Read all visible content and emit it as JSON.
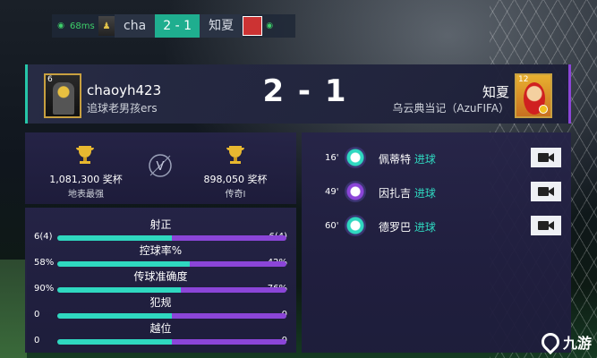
{
  "topbar": {
    "ping": "68ms",
    "home_name": "cha",
    "score": "2 - 1",
    "away_name": "知夏"
  },
  "header": {
    "home": {
      "name": "chaoyh423",
      "team": "追球老男孩ers",
      "level": "6"
    },
    "score": "2 - 1",
    "away": {
      "name": "知夏",
      "team": "乌云典当记（AzuFIFA）",
      "level": "12"
    }
  },
  "trophies": {
    "home": {
      "value": "1,081,300 奖杯",
      "rank": "地表最强"
    },
    "away": {
      "value": "898,050 奖杯",
      "rank": "传奇I"
    },
    "vs": "V"
  },
  "stats": [
    {
      "label": "射正",
      "home": "6(4)",
      "away": "6(4)",
      "home_frac": 0.5
    },
    {
      "label": "控球率%",
      "home": "58%",
      "away": "42%",
      "home_frac": 0.58
    },
    {
      "label": "传球准确度",
      "home": "90%",
      "away": "76%",
      "home_frac": 0.54
    },
    {
      "label": "犯规",
      "home": "0",
      "away": "0",
      "home_frac": 0.5
    },
    {
      "label": "越位",
      "home": "0",
      "away": "0",
      "home_frac": 0.5
    }
  ],
  "goals": [
    {
      "minute": "16'",
      "player": "佩蒂特",
      "tag": "进球",
      "side": "home"
    },
    {
      "minute": "49'",
      "player": "因扎吉",
      "tag": "进球",
      "side": "away"
    },
    {
      "minute": "60'",
      "player": "德罗巴",
      "tag": "进球",
      "side": "home"
    }
  ],
  "watermark": "九游",
  "colors": {
    "home": "#2fd8c0",
    "away": "#8b45d8",
    "gold": "#c8a040"
  }
}
